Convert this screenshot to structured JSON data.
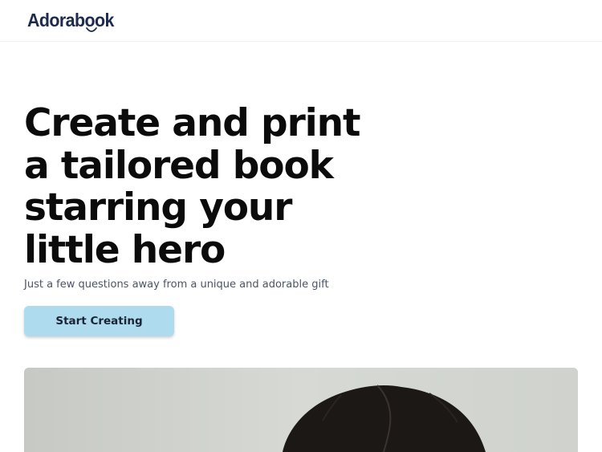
{
  "navbar": {
    "logo_text": "Adorabook"
  },
  "hero": {
    "headline_lines": [
      "Create and print",
      "a tailored book",
      "starring your",
      "little hero"
    ],
    "subtitle": "Just a few questions away from a unique and adorable gift",
    "cta_label": "Start Creating"
  },
  "colors": {
    "brand": "#1c2a4d",
    "cta_background": "#aedcee",
    "headline": "#0b0b0b"
  }
}
